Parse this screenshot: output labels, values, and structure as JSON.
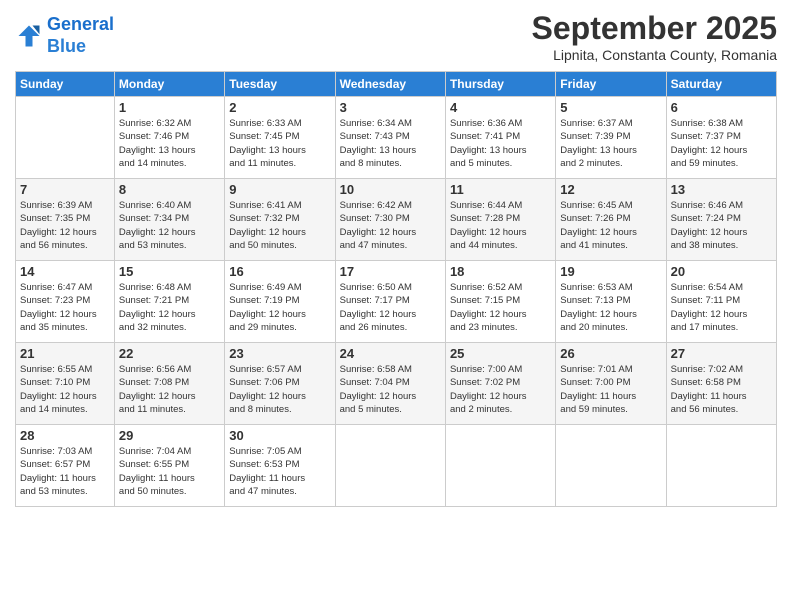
{
  "header": {
    "logo_line1": "General",
    "logo_line2": "Blue",
    "month": "September 2025",
    "location": "Lipnita, Constanta County, Romania"
  },
  "weekdays": [
    "Sunday",
    "Monday",
    "Tuesday",
    "Wednesday",
    "Thursday",
    "Friday",
    "Saturday"
  ],
  "weeks": [
    [
      {
        "day": "",
        "info": ""
      },
      {
        "day": "1",
        "info": "Sunrise: 6:32 AM\nSunset: 7:46 PM\nDaylight: 13 hours\nand 14 minutes."
      },
      {
        "day": "2",
        "info": "Sunrise: 6:33 AM\nSunset: 7:45 PM\nDaylight: 13 hours\nand 11 minutes."
      },
      {
        "day": "3",
        "info": "Sunrise: 6:34 AM\nSunset: 7:43 PM\nDaylight: 13 hours\nand 8 minutes."
      },
      {
        "day": "4",
        "info": "Sunrise: 6:36 AM\nSunset: 7:41 PM\nDaylight: 13 hours\nand 5 minutes."
      },
      {
        "day": "5",
        "info": "Sunrise: 6:37 AM\nSunset: 7:39 PM\nDaylight: 13 hours\nand 2 minutes."
      },
      {
        "day": "6",
        "info": "Sunrise: 6:38 AM\nSunset: 7:37 PM\nDaylight: 12 hours\nand 59 minutes."
      }
    ],
    [
      {
        "day": "7",
        "info": "Sunrise: 6:39 AM\nSunset: 7:35 PM\nDaylight: 12 hours\nand 56 minutes."
      },
      {
        "day": "8",
        "info": "Sunrise: 6:40 AM\nSunset: 7:34 PM\nDaylight: 12 hours\nand 53 minutes."
      },
      {
        "day": "9",
        "info": "Sunrise: 6:41 AM\nSunset: 7:32 PM\nDaylight: 12 hours\nand 50 minutes."
      },
      {
        "day": "10",
        "info": "Sunrise: 6:42 AM\nSunset: 7:30 PM\nDaylight: 12 hours\nand 47 minutes."
      },
      {
        "day": "11",
        "info": "Sunrise: 6:44 AM\nSunset: 7:28 PM\nDaylight: 12 hours\nand 44 minutes."
      },
      {
        "day": "12",
        "info": "Sunrise: 6:45 AM\nSunset: 7:26 PM\nDaylight: 12 hours\nand 41 minutes."
      },
      {
        "day": "13",
        "info": "Sunrise: 6:46 AM\nSunset: 7:24 PM\nDaylight: 12 hours\nand 38 minutes."
      }
    ],
    [
      {
        "day": "14",
        "info": "Sunrise: 6:47 AM\nSunset: 7:23 PM\nDaylight: 12 hours\nand 35 minutes."
      },
      {
        "day": "15",
        "info": "Sunrise: 6:48 AM\nSunset: 7:21 PM\nDaylight: 12 hours\nand 32 minutes."
      },
      {
        "day": "16",
        "info": "Sunrise: 6:49 AM\nSunset: 7:19 PM\nDaylight: 12 hours\nand 29 minutes."
      },
      {
        "day": "17",
        "info": "Sunrise: 6:50 AM\nSunset: 7:17 PM\nDaylight: 12 hours\nand 26 minutes."
      },
      {
        "day": "18",
        "info": "Sunrise: 6:52 AM\nSunset: 7:15 PM\nDaylight: 12 hours\nand 23 minutes."
      },
      {
        "day": "19",
        "info": "Sunrise: 6:53 AM\nSunset: 7:13 PM\nDaylight: 12 hours\nand 20 minutes."
      },
      {
        "day": "20",
        "info": "Sunrise: 6:54 AM\nSunset: 7:11 PM\nDaylight: 12 hours\nand 17 minutes."
      }
    ],
    [
      {
        "day": "21",
        "info": "Sunrise: 6:55 AM\nSunset: 7:10 PM\nDaylight: 12 hours\nand 14 minutes."
      },
      {
        "day": "22",
        "info": "Sunrise: 6:56 AM\nSunset: 7:08 PM\nDaylight: 12 hours\nand 11 minutes."
      },
      {
        "day": "23",
        "info": "Sunrise: 6:57 AM\nSunset: 7:06 PM\nDaylight: 12 hours\nand 8 minutes."
      },
      {
        "day": "24",
        "info": "Sunrise: 6:58 AM\nSunset: 7:04 PM\nDaylight: 12 hours\nand 5 minutes."
      },
      {
        "day": "25",
        "info": "Sunrise: 7:00 AM\nSunset: 7:02 PM\nDaylight: 12 hours\nand 2 minutes."
      },
      {
        "day": "26",
        "info": "Sunrise: 7:01 AM\nSunset: 7:00 PM\nDaylight: 11 hours\nand 59 minutes."
      },
      {
        "day": "27",
        "info": "Sunrise: 7:02 AM\nSunset: 6:58 PM\nDaylight: 11 hours\nand 56 minutes."
      }
    ],
    [
      {
        "day": "28",
        "info": "Sunrise: 7:03 AM\nSunset: 6:57 PM\nDaylight: 11 hours\nand 53 minutes."
      },
      {
        "day": "29",
        "info": "Sunrise: 7:04 AM\nSunset: 6:55 PM\nDaylight: 11 hours\nand 50 minutes."
      },
      {
        "day": "30",
        "info": "Sunrise: 7:05 AM\nSunset: 6:53 PM\nDaylight: 11 hours\nand 47 minutes."
      },
      {
        "day": "",
        "info": ""
      },
      {
        "day": "",
        "info": ""
      },
      {
        "day": "",
        "info": ""
      },
      {
        "day": "",
        "info": ""
      }
    ]
  ]
}
